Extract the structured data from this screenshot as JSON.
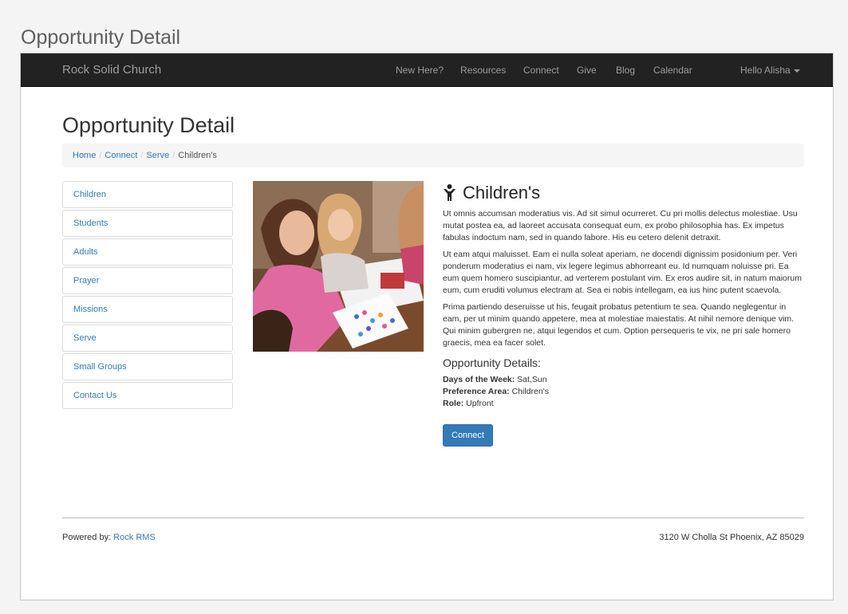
{
  "outer_title": "Opportunity Detail",
  "navbar": {
    "brand": "Rock Solid Church",
    "items": [
      "New Here?",
      "Resources",
      "Connect",
      "Give",
      "Blog",
      "Calendar"
    ],
    "user": "Hello Alisha"
  },
  "page": {
    "title": "Opportunity Detail"
  },
  "breadcrumb": {
    "links": [
      "Home",
      "Connect",
      "Serve"
    ],
    "current": "Children's"
  },
  "sidebar": {
    "items": [
      "Children",
      "Students",
      "Adults",
      "Prayer",
      "Missions",
      "Serve",
      "Small Groups",
      "Contact Us"
    ]
  },
  "opportunity": {
    "title": "Children's",
    "icon": "child-icon",
    "paragraphs": [
      "Ut omnis accumsan moderatius vis. Ad sit simul ocurreret. Cu pri mollis delectus molestiae. Usu mutat postea ea, ad laoreet accusata consequat eum, ex probo philosophia has. Ex impetus fabulas indoctum nam, sed in quando labore. His eu cetero delenit detraxit.",
      "Ut eam atqui maluisset. Eam ei nulla soleat aperiam, ne docendi dignissim posidonium per. Veri ponderum moderatius ei nam, vix legere legimus abhorreant eu. Id numquam noluisse pri. Ea eum quem homero suscipiantur, ad verterem postulant vim. Ex eros audire sit, in natum maiorum eum, cum eruditi volumus electram at. Sea ei nobis intellegam, ea ius hinc putent scaevola.",
      "Prima partiendo deseruisse ut his, feugait probatus petentium te sea. Quando neglegentur in eam, per ut minim quando appetere, mea at molestiae maiestatis. At nihil nemore denique vim. Qui minim gubergren ne, atqui legendos et cum. Option persequeris te vix, ne pri sale homero graecis, mea ea facer solet."
    ],
    "details_title": "Opportunity Details:",
    "details": [
      {
        "label": "Days of the Week:",
        "value": "Sat,Sun"
      },
      {
        "label": "Preference Area:",
        "value": "Children's"
      },
      {
        "label": "Role:",
        "value": "Upfront"
      }
    ],
    "button": "Connect"
  },
  "footer": {
    "powered_prefix": "Powered by:",
    "powered_link": "Rock RMS",
    "address": "3120 W Cholla St Phoenix, AZ 85029"
  },
  "colors": {
    "navbar_bg": "#222222",
    "link": "#337ab7",
    "button": "#337ab7"
  }
}
